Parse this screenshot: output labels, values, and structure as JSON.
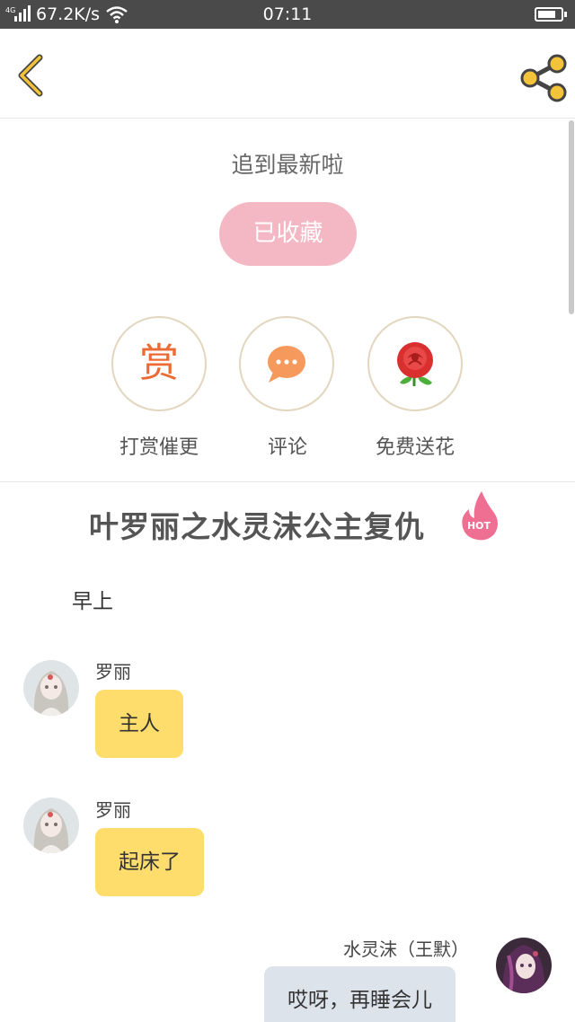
{
  "status_bar": {
    "network": "4G",
    "speed": "67.2K/s",
    "time": "07:11",
    "battery_level": 0.8
  },
  "nav": {
    "back_icon": "chevron-left-icon",
    "share_icon": "share-icon",
    "accent_color": "#f3c33a"
  },
  "follow": {
    "caught_up_text": "追到最新啦",
    "favorite_button": "已收藏",
    "favorite_color": "#f4b8c4"
  },
  "actions": [
    {
      "label": "打赏催更",
      "icon": "reward-icon",
      "glyph": "赏"
    },
    {
      "label": "评论",
      "icon": "comment-icon"
    },
    {
      "label": "免费送花",
      "icon": "rose-icon"
    }
  ],
  "story": {
    "title": "叶罗丽之水灵沫公主复仇",
    "badge": "HOT",
    "narration": "早上"
  },
  "messages": [
    {
      "sender": "罗丽",
      "text": "主人",
      "side": "left"
    },
    {
      "sender": "罗丽",
      "text": "起床了",
      "side": "left"
    },
    {
      "sender": "水灵沫（王默）",
      "text": "哎呀，再睡会儿",
      "side": "right"
    }
  ],
  "colors": {
    "left_bubble": "#fedd6c",
    "right_bubble": "#dde3ea",
    "hot": "#ef6f93",
    "reward": "#ec6a34",
    "comment": "#f59a5c"
  }
}
